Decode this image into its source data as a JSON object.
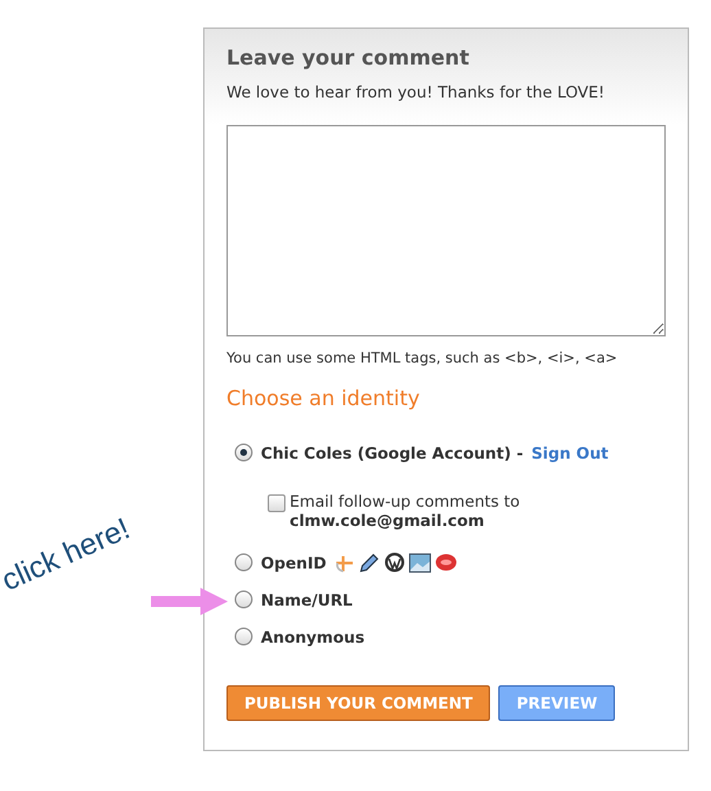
{
  "panel": {
    "title": "Leave your comment",
    "subtitle": "We love to hear from you! Thanks for the LOVE!",
    "html_hint": "You can use some HTML tags, such as <b>, <i>, <a>"
  },
  "identity": {
    "heading": "Choose an identity",
    "options": [
      {
        "kind": "account",
        "label": "Chic Coles (Google Account) -",
        "link": "Sign Out",
        "selected": true,
        "email_option": {
          "label": "Email follow-up comments to",
          "address": "clmw.cole@gmail.com",
          "checked": false
        }
      },
      {
        "kind": "openid",
        "label": "OpenID",
        "selected": false
      },
      {
        "kind": "plain",
        "label": "Name/URL",
        "selected": false
      },
      {
        "kind": "plain",
        "label": "Anonymous",
        "selected": false
      }
    ]
  },
  "buttons": [
    {
      "label": "PUBLISH YOUR COMMENT",
      "kind": "primary"
    },
    {
      "label": "PREVIEW",
      "kind": "secondary"
    }
  ],
  "annotation": {
    "text": "click here!"
  }
}
